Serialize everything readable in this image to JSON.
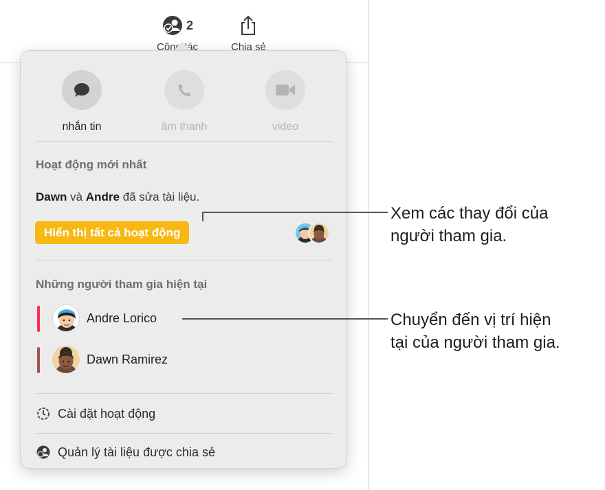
{
  "toolbar": {
    "collaborate": {
      "icon": "collaborate-icon",
      "count": "2",
      "label": "Cộng tác"
    },
    "share": {
      "icon": "share-icon",
      "label": "Chia sẻ"
    }
  },
  "popover": {
    "actions": [
      {
        "icon": "message-icon",
        "label": "nhắn tin",
        "enabled": true
      },
      {
        "icon": "phone-icon",
        "label": "âm thanh",
        "enabled": false
      },
      {
        "icon": "video-icon",
        "label": "video",
        "enabled": false
      }
    ],
    "latest_activity": {
      "title": "Hoạt động mới nhất",
      "name1": "Dawn",
      "connector": "và",
      "name2": "Andre",
      "suffix": "đã sửa tài liệu.",
      "show_all_label": "Hiển thị tất cả hoạt động"
    },
    "participants": {
      "title": "Những người tham gia hiện tại",
      "items": [
        {
          "name": "Andre Lorico",
          "color": "#ff2d55"
        },
        {
          "name": "Dawn Ramirez",
          "color": "#a2574a"
        }
      ]
    },
    "menu": {
      "settings": {
        "icon": "activity-settings-icon",
        "label": "Cài đặt hoạt động"
      },
      "manage": {
        "icon": "manage-shared-icon",
        "label": "Quản lý tài liệu được chia sẻ"
      }
    }
  },
  "callouts": {
    "activity": [
      "Xem các thay đổi của",
      "người tham gia."
    ],
    "location": [
      "Chuyển đến vị trí hiện",
      "tại của người tham gia."
    ]
  },
  "colors": {
    "accent": "#f8b711",
    "popover_bg": "#ececec"
  }
}
